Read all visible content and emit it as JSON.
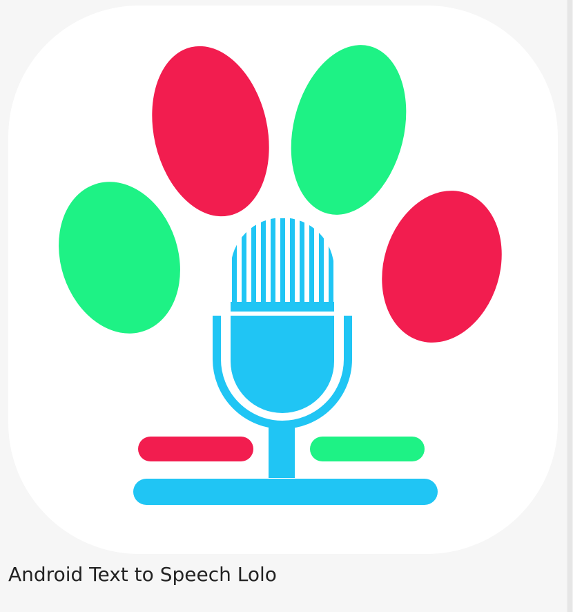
{
  "caption": {
    "text": "Android Text to Speech Lolo"
  },
  "icon": {
    "name": "paw-microphone-icon",
    "colors": {
      "red": "#f21d4f",
      "green": "#1ef285",
      "blue": "#20c5f4",
      "card": "#ffffff",
      "background": "#f6f6f6"
    }
  }
}
